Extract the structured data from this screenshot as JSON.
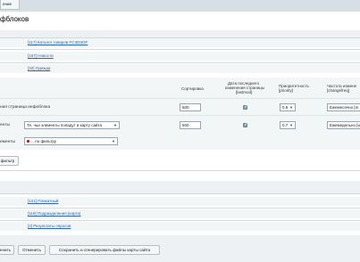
{
  "tab_label": "ение",
  "page_title": "фблоков",
  "iblocks_top": [
    "[117] Каталог товаров FC4DSDF",
    "[167] Новости",
    "[32] Одежда"
  ],
  "columns": {
    "sort": "Сортировка",
    "lastmod_l1": "Дата последнего",
    "lastmod_l2": "изменения страницы",
    "lastmod_l3": "[lastmod]",
    "priority_l1": "Приоритетность",
    "priority_l2": "[priority]",
    "freq_l1": "Частота измене",
    "freq_l2": "[changefreq]"
  },
  "row_main": {
    "label": "ная страница инфоблока",
    "sort": "500",
    "lastmod_checked": true,
    "priority": "0.5",
    "freq": "Ежемесячно [m"
  },
  "row_elements": {
    "label": "енты",
    "select": "Те, чьи элементы попадут в карту сайта",
    "sort": "500",
    "lastmod_checked": true,
    "priority": "0.7",
    "freq": "Ежемедельно [w"
  },
  "row_filter": {
    "label": "ементы",
    "select": "... по фильтру"
  },
  "filter_button": "фильтр",
  "iblocks_bottom": [
    "[121] Плакатный",
    "[119] Подразделения (карта)",
    "[2] Результаты опросов"
  ],
  "buttons": {
    "apply": "енить",
    "cancel": "Отменить",
    "save_generate": "Сохранить и сгенерировать файлы карты сайта"
  }
}
